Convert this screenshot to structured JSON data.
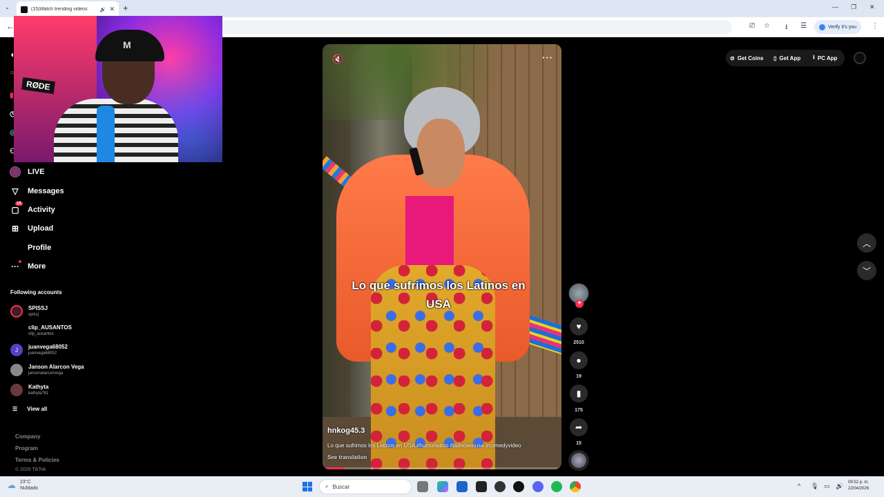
{
  "browser": {
    "tab_title": "(15)Watch trending videos",
    "verify_label": "Verify it's you"
  },
  "sidebar": {
    "nav": [
      {
        "label": "LIVE",
        "icon": "live-icon"
      },
      {
        "label": "Messages",
        "icon": "messages-icon"
      },
      {
        "label": "Activity",
        "icon": "activity-icon",
        "badge": "15"
      },
      {
        "label": "Upload",
        "icon": "upload-icon"
      },
      {
        "label": "Profile",
        "icon": "profile-icon"
      },
      {
        "label": "More",
        "icon": "more-icon"
      }
    ],
    "following_heading": "Following accounts",
    "accounts": [
      {
        "name": "SPISSJ",
        "handle": "spissj"
      },
      {
        "name": "clip_AUSANTOS",
        "handle": "clip_ausantos"
      },
      {
        "name": "juanvega68052",
        "handle": "juanvega68052",
        "initial": "J"
      },
      {
        "name": "Janson Alarcon Vega",
        "handle": "jansonalarconvega"
      },
      {
        "name": "Kathyta",
        "handle": "kathyta781"
      }
    ],
    "view_all": "View all",
    "footer_links": [
      "Company",
      "Program",
      "Terms & Policies"
    ],
    "copyright": "© 2026 TikTok"
  },
  "topbar": {
    "get_coins": "Get Coins",
    "get_app": "Get App",
    "pc_app": "PC App"
  },
  "webcam": {
    "mic_brand": "RØDE"
  },
  "video": {
    "overlay_text": "Lo que sufrimos los Latinos en USA",
    "username": "hnkog45.3",
    "description": "Lo que sufrimos los Latinos en USA #humorlatino #latinosenusa #comedyvideo",
    "see_translation": "See translation",
    "progress": 0.09,
    "likes": "2510",
    "comments": "19",
    "saves": "175",
    "shares": "15"
  },
  "taskbar": {
    "temp": "23°C",
    "condition": "Nublado",
    "search_placeholder": "Buscar",
    "time": "09:52 p. m.",
    "date": "22/04/2026"
  },
  "colors": {
    "accent": "#fe2c55",
    "background": "#000000"
  }
}
